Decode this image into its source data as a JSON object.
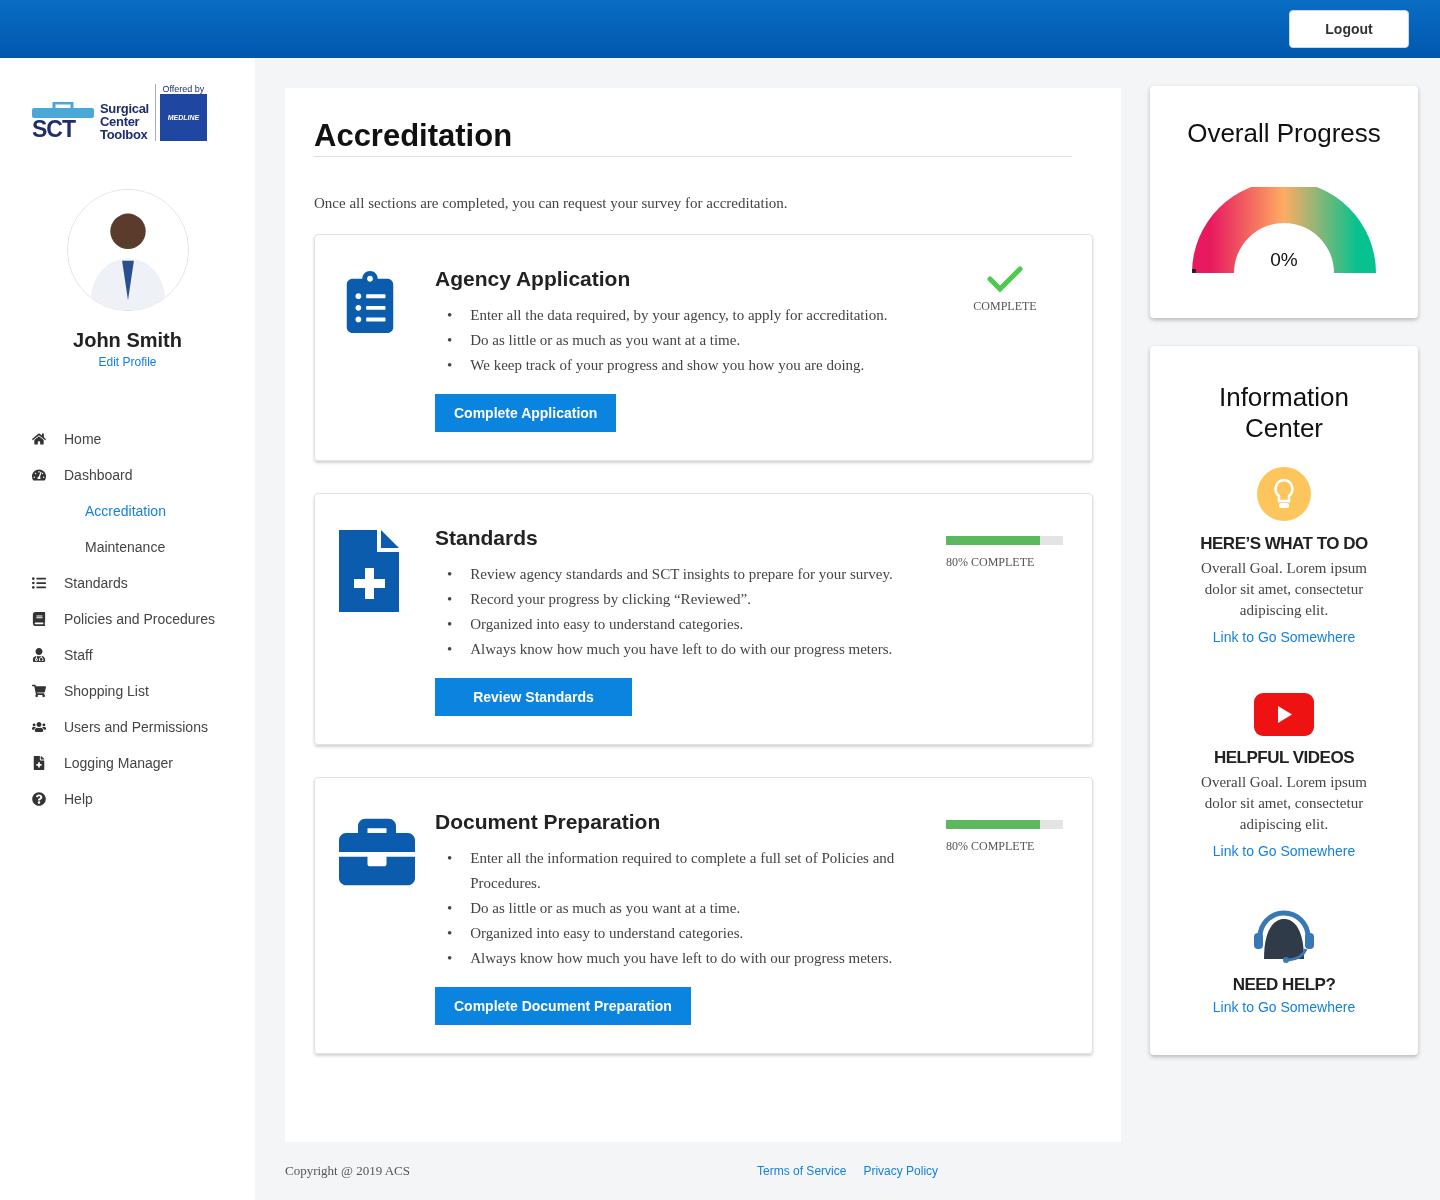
{
  "top_bar": {
    "logout_button": "Logout"
  },
  "sidebar": {
    "logo": {
      "letters": "SCT",
      "name_lines": [
        "Surgical",
        "Center",
        "Toolbox"
      ],
      "offered_by": "Offered by",
      "partner": "MEDLINE"
    },
    "user": {
      "name": "John Smith",
      "edit_link": "Edit Profile"
    },
    "nav": [
      {
        "label": "Home",
        "selected": false
      },
      {
        "label": "Dashboard",
        "selected": false,
        "children": [
          {
            "label": "Accreditation",
            "selected": true
          },
          {
            "label": "Maintenance",
            "selected": false
          }
        ]
      },
      {
        "label": "Standards",
        "selected": false
      },
      {
        "label": "Policies and Procedures",
        "selected": false
      },
      {
        "label": "Staff",
        "selected": false
      },
      {
        "label": "Shopping List",
        "selected": false
      },
      {
        "label": "Users and Permissions",
        "selected": false
      },
      {
        "label": "Logging Manager",
        "selected": false
      },
      {
        "label": "Help",
        "selected": false
      }
    ]
  },
  "main": {
    "title": "Accreditation",
    "bullet_marker": "•",
    "intro": "Once all sections are completed, you can request your survey for accreditation.",
    "sections": [
      {
        "title": "Agency Application",
        "kind": "complete",
        "status": "COMPLETE",
        "bullets": [
          "Enter all the data required, by your agency, to apply for accreditation.",
          "Do as little or as much as you want at a time.",
          "We keep track of your progress and show you how you are doing."
        ],
        "button": "Complete Application"
      },
      {
        "title": "Standards",
        "kind": "progress",
        "level": 0.8,
        "status": "80% COMPLETE",
        "bullets": [
          "Review agency standards and SCT insights to prepare for your survey.",
          "Record your progress by clicking “Reviewed”.",
          "Organized into easy to understand categories.",
          "Always know how much you have left to do with our progress meters."
        ],
        "button": "Review Standards"
      },
      {
        "title": "Document Preparation",
        "kind": "progress",
        "level": 0.8,
        "status": "80% COMPLETE",
        "bullets": [
          "Enter all the information required to complete a full set of Policies and Procedures.",
          "Do as little or as much as you want at a time.",
          "Organized into easy to understand categories.",
          "Always know how much you have left to do with our progress meters."
        ],
        "button": "Complete Document Preparation"
      }
    ]
  },
  "overall_progress": {
    "title": "Overall Progress",
    "level": 0,
    "reading": "0%"
  },
  "information_center": {
    "title": "Information Center",
    "blocks": [
      {
        "kind": "tips",
        "heading": "HERE’S WHAT TO DO",
        "text": "Overall Goal. Lorem ipsum dolor sit amet, consectetur adipiscing elit.",
        "link": "Link to Go Somewhere"
      },
      {
        "kind": "videos",
        "heading": "HELPFUL VIDEOS",
        "text": "Overall Goal. Lorem ipsum dolor sit amet, consectetur adipiscing elit.",
        "link": "Link to Go Somewhere"
      },
      {
        "kind": "help",
        "heading": "NEED HELP?",
        "link": "Link to Go Somewhere"
      }
    ]
  },
  "footer": {
    "copyright": "Copyright @ 2019 ACS",
    "links": [
      "Terms of Service",
      "Privacy Policy"
    ]
  }
}
